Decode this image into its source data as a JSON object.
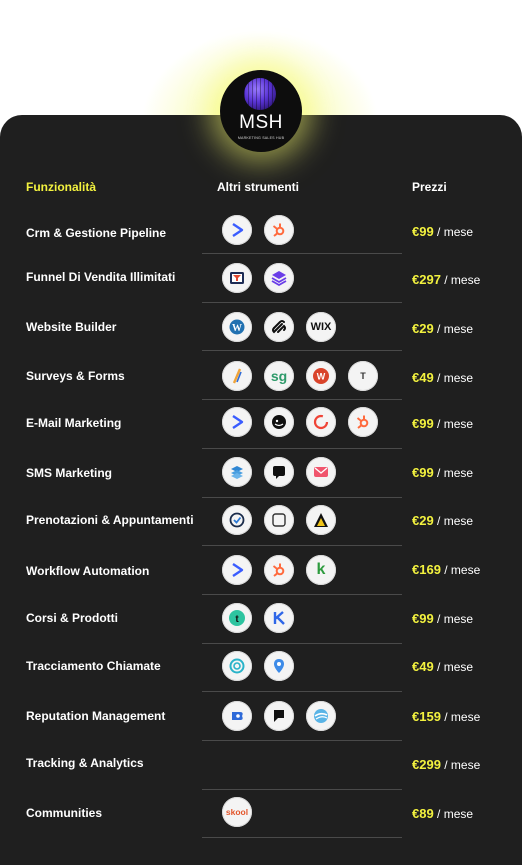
{
  "brand": {
    "name": "MSH",
    "tagline": "MARKETING SALES HUB"
  },
  "headers": {
    "features": "Funzionalità",
    "tools": "Altri strumenti",
    "prices": "Prezzi"
  },
  "colors": {
    "accent": "#f3f23f",
    "card": "#1f1f1f"
  },
  "rows": [
    {
      "feature": "Crm & Gestione Pipeline",
      "price": "€99",
      "period": "/ mese",
      "icons": [
        "activecampaign-icon",
        "hubspot-icon"
      ]
    },
    {
      "feature": "Funnel Di Vendita Illimitati",
      "price": "€297",
      "period": "/ mese",
      "icons": [
        "clickfunnels-icon",
        "layers-icon"
      ]
    },
    {
      "feature": "Website Builder",
      "price": "€29",
      "period": "/ mese",
      "icons": [
        "wordpress-icon",
        "squarespace-icon",
        "wix-icon"
      ]
    },
    {
      "feature": "Surveys & Forms",
      "price": "€49",
      "period": "/ mese",
      "icons": [
        "jotform-icon",
        "surveygizmo-icon",
        "wufoo-icon",
        "typeform-icon"
      ]
    },
    {
      "feature": "E-Mail Marketing",
      "price": "€99",
      "period": "/ mese",
      "icons": [
        "activecampaign-icon",
        "mailchimp-icon",
        "constantcontact-icon",
        "hubspot-icon"
      ]
    },
    {
      "feature": "SMS Marketing",
      "price": "€99",
      "period": "/ mese",
      "icons": [
        "simpletexting-icon",
        "textedly-icon",
        "envelope-icon"
      ]
    },
    {
      "feature": "Prenotazioni & Appuntamenti",
      "price": "€29",
      "period": "/ mese",
      "icons": [
        "calendly-icon",
        "square-icon",
        "acuity-icon"
      ]
    },
    {
      "feature": "Workflow Automation",
      "price": "€169",
      "period": "/ mese",
      "icons": [
        "activecampaign-icon",
        "hubspot-icon",
        "keap-icon"
      ]
    },
    {
      "feature": "Corsi & Prodotti",
      "price": "€99",
      "period": "/ mese",
      "icons": [
        "teachable-icon",
        "kajabi-icon"
      ]
    },
    {
      "feature": "Tracciamento Chiamate",
      "price": "€49",
      "period": "/ mese",
      "icons": [
        "callrail-icon",
        "location-pin-icon"
      ]
    },
    {
      "feature": "Reputation Management",
      "price": "€159",
      "period": "/ mese",
      "icons": [
        "birdeye-icon",
        "podium-icon",
        "wave-icon"
      ]
    },
    {
      "feature": "Tracking & Analytics",
      "price": "€299",
      "period": "/ mese",
      "icons": []
    },
    {
      "feature": "Communities",
      "price": "€89",
      "period": "/ mese",
      "icons": [
        "skool-icon"
      ]
    }
  ],
  "icon_text": {
    "wix": "WIX",
    "surveygizmo": "sg",
    "typeform": "T",
    "keap": "k",
    "skool": "skool"
  }
}
